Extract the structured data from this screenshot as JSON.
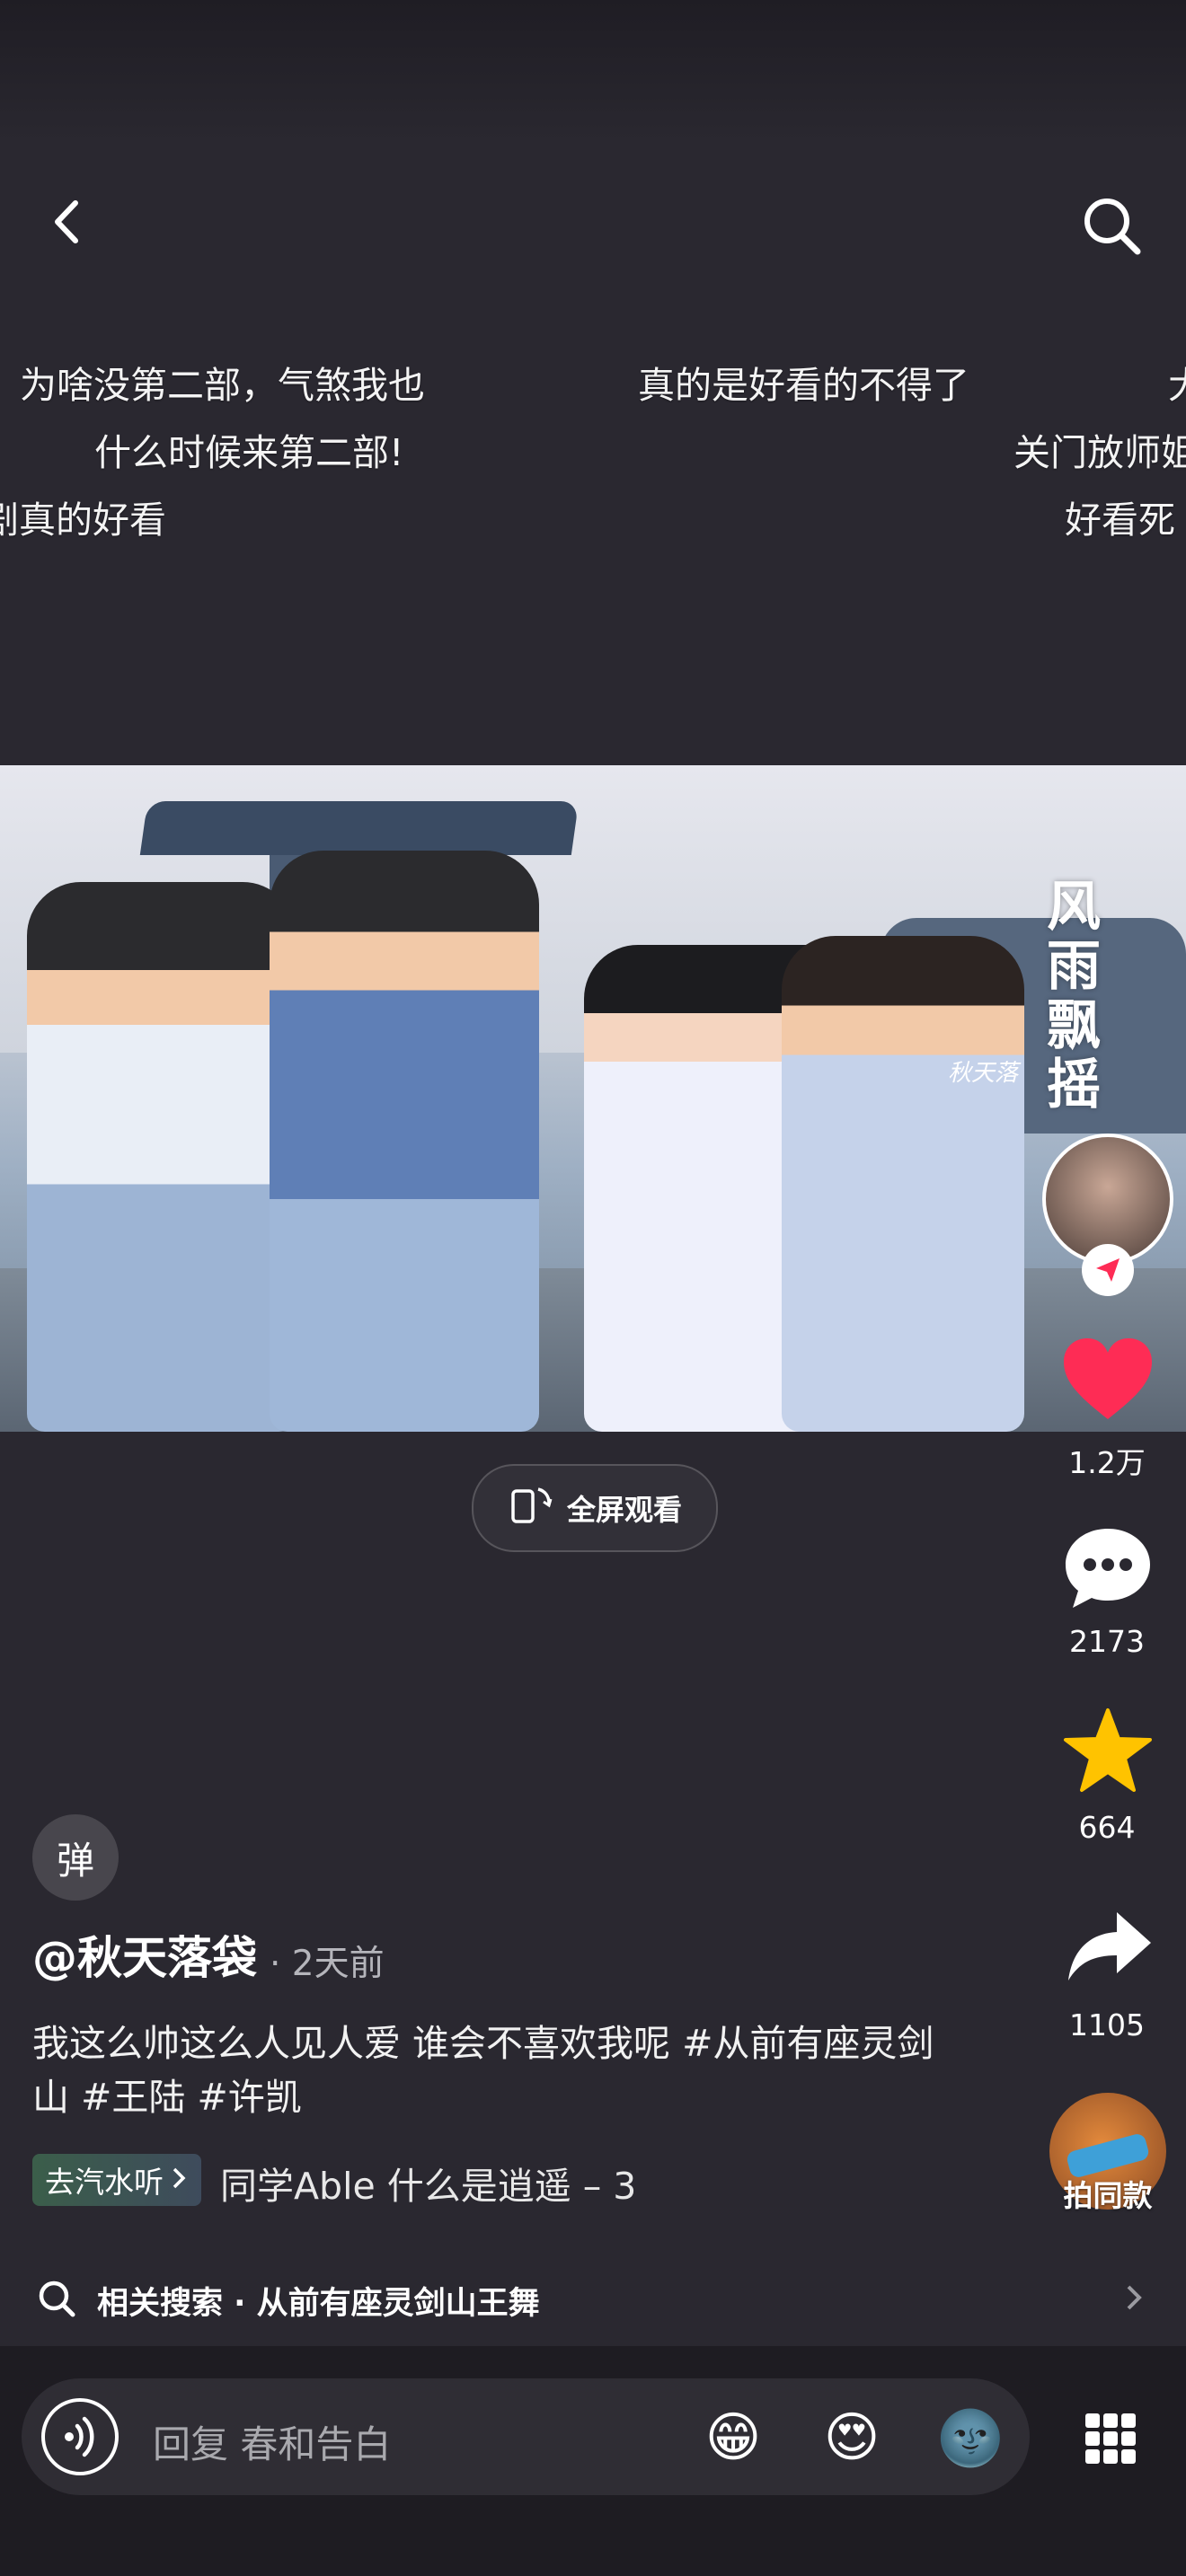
{
  "danmaku": [
    {
      "text": "为啥没第二部，气煞我也"
    },
    {
      "text": "真的是好看的不得了"
    },
    {
      "text": "大"
    },
    {
      "text": "什么时候来第二部!"
    },
    {
      "text": "关门放师姐"
    },
    {
      "text": "剧真的好看"
    },
    {
      "text": "好看死"
    }
  ],
  "video": {
    "watermark_title": "风雨飘摇",
    "signature": "秋天落"
  },
  "fullscreen_label": "全屏观看",
  "side": {
    "likes": "1.2万",
    "comments": "2173",
    "favorites": "664",
    "shares": "1105",
    "same_style": "拍同款"
  },
  "danmu_toggle": "弹",
  "author": "@秋天落袋",
  "time": "· 2天前",
  "caption": "我这么帅这么人见人爱 谁会不喜欢我呢 #从前有座灵剑山 #王陆 #许凯",
  "music": {
    "tag": "去汽水听",
    "text": "同学Able    什么是逍遥 – 3"
  },
  "related": {
    "label": "相关搜索 · 从前有座灵剑山王舞"
  },
  "reply": {
    "placeholder": "回复 春和告白",
    "emojis": [
      "😁",
      "😍",
      "🌚"
    ]
  },
  "colors": {
    "like": "#fe2c55",
    "favorite": "#ffc300",
    "background": "#2a2830"
  }
}
